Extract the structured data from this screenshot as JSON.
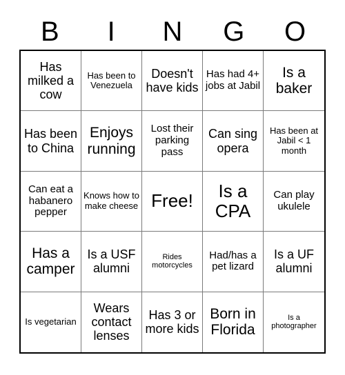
{
  "card": {
    "header_letters": [
      "B",
      "I",
      "N",
      "G",
      "O"
    ],
    "columns": 5,
    "rows": 5,
    "free_space_index": 12,
    "colors": {
      "background": "#ffffff",
      "text": "#000000",
      "outer_border": "#000000",
      "inner_border": "#7a7a7a"
    },
    "cells": [
      {
        "text": "Has milked a cow",
        "size": "lg"
      },
      {
        "text": "Has been to Venezuela",
        "size": "sm"
      },
      {
        "text": "Doesn't have kids",
        "size": "lg"
      },
      {
        "text": "Has had 4+ jobs at Jabil",
        "size": "md"
      },
      {
        "text": "Is a baker",
        "size": "xl"
      },
      {
        "text": "Has been to China",
        "size": "lg"
      },
      {
        "text": "Enjoys running",
        "size": "xl"
      },
      {
        "text": "Lost their parking pass",
        "size": "md"
      },
      {
        "text": "Can sing opera",
        "size": "lg"
      },
      {
        "text": "Has been at Jabil < 1 month",
        "size": "sm"
      },
      {
        "text": "Can eat a habanero pepper",
        "size": "md"
      },
      {
        "text": "Knows how to make cheese",
        "size": "sm"
      },
      {
        "text": "Free!",
        "size": "xxl"
      },
      {
        "text": "Is a CPA",
        "size": "xxl"
      },
      {
        "text": "Can play ukulele",
        "size": "md"
      },
      {
        "text": "Has a camper",
        "size": "xl"
      },
      {
        "text": "Is a USF alumni",
        "size": "lg"
      },
      {
        "text": "Rides motorcycles",
        "size": "xs"
      },
      {
        "text": "Had/has a pet lizard",
        "size": "md"
      },
      {
        "text": "Is a UF alumni",
        "size": "lg"
      },
      {
        "text": "Is vegetarian",
        "size": "sm"
      },
      {
        "text": "Wears contact lenses",
        "size": "lg"
      },
      {
        "text": "Has 3 or more kids",
        "size": "lg"
      },
      {
        "text": "Born in Florida",
        "size": "xl"
      },
      {
        "text": "Is a photographer",
        "size": "xs"
      }
    ]
  }
}
